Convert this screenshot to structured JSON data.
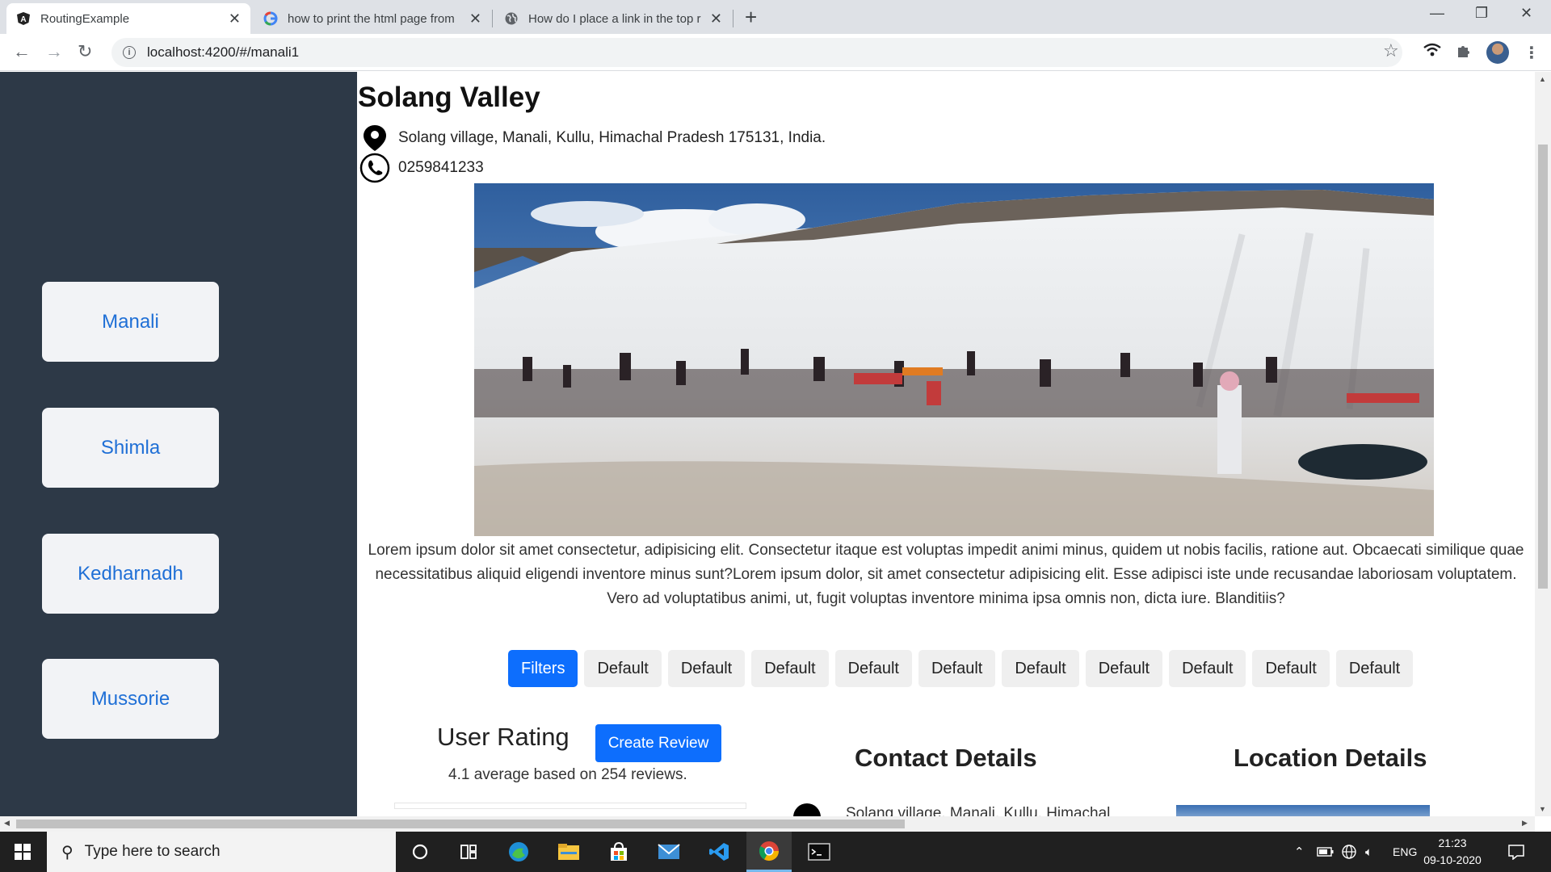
{
  "browser": {
    "tabs": [
      {
        "title": "RoutingExample",
        "active": true
      },
      {
        "title": "how to print the html page from",
        "active": false
      },
      {
        "title": "How do I place a link in the top r",
        "active": false
      }
    ],
    "url": "localhost:4200/#/manali1"
  },
  "sidebar": {
    "items": [
      {
        "label": "Manali"
      },
      {
        "label": "Shimla"
      },
      {
        "label": "Kedharnadh"
      },
      {
        "label": "Mussorie"
      }
    ]
  },
  "place": {
    "title": "Solang Valley",
    "address": "Solang village, Manali, Kullu, Himachal Pradesh 175131, India.",
    "phone": "0259841233",
    "description": "Lorem ipsum dolor sit amet consectetur, adipisicing elit. Consectetur itaque est voluptas impedit animi minus, quidem ut nobis facilis, ratione aut. Obcaecati similique quae necessitatibus aliquid eligendi inventore minus sunt?Lorem ipsum dolor, sit amet consectetur adipisicing elit. Esse adipisci iste unde recusandae laboriosam voluptatem. Vero ad voluptatibus animi, ut, fugit voluptas inventore minima ipsa omnis non, dicta iure. Blanditiis?"
  },
  "filters": {
    "primary": "Filters",
    "buttons": [
      "Default",
      "Default",
      "Default",
      "Default",
      "Default",
      "Default",
      "Default",
      "Default",
      "Default",
      "Default"
    ]
  },
  "rating": {
    "title": "User Rating",
    "create_review": "Create Review",
    "summary": "4.1 average based on 254 reviews."
  },
  "sections": {
    "contact_title": "Contact Details",
    "location_title": "Location Details",
    "contact_peek": "Solang village, Manali, Kullu, Himachal"
  },
  "taskbar": {
    "search_placeholder": "Type here to search",
    "lang": "ENG",
    "time": "21:23",
    "date": "09-10-2020"
  },
  "colors": {
    "sidebar_bg": "#2d3947",
    "primary_blue": "#0d6efd",
    "link_blue": "#1f6fd6"
  }
}
